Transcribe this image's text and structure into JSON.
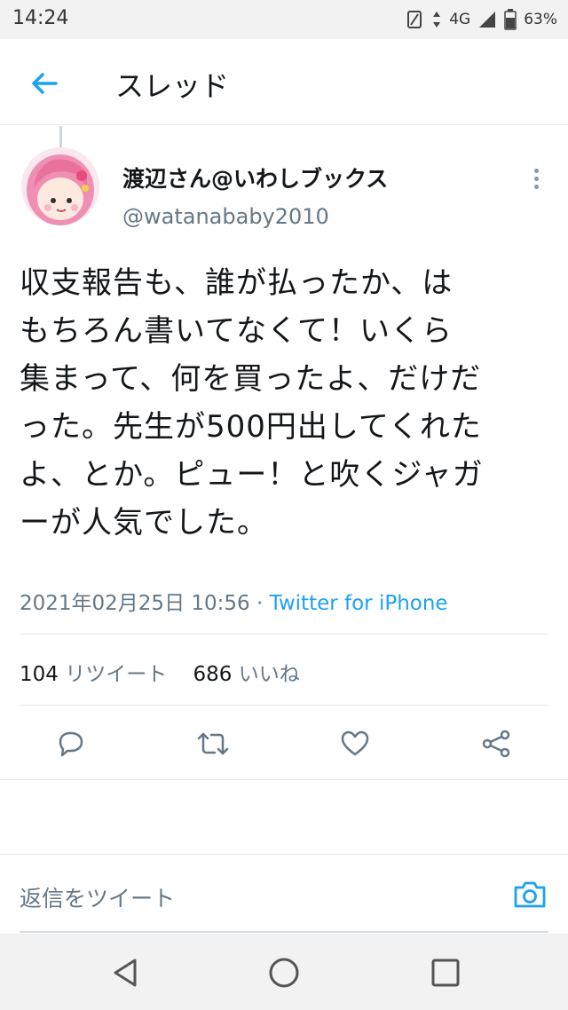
{
  "status": {
    "time": "14:24",
    "network": "4G",
    "battery": "63%"
  },
  "header": {
    "title": "スレッド",
    "back_icon": "arrow-left-icon"
  },
  "tweet": {
    "display_name": "渡辺さん@いわしブックス",
    "handle": "@watanababy2010",
    "lines": [
      "収支報告も、誰が払ったか、は",
      "もちろん書いてなくて！いくら",
      "集まって、何を買ったよ、だけだ",
      "った。先生が500円出してくれた",
      "よ、とか。ピュー！と吹くジャガ",
      "ーが人気でした。"
    ],
    "timestamp": "2021年02月25日 10:56",
    "separator": " · ",
    "source": "Twitter for iPhone",
    "retweet_count": "104",
    "retweet_label": "リツイート",
    "like_count": "686",
    "like_label": "いいね"
  },
  "actions": [
    "reply-icon",
    "retweet-icon",
    "like-icon",
    "share-icon"
  ],
  "reply": {
    "placeholder": "返信をツイート",
    "camera_icon": "camera-icon"
  },
  "colors": {
    "accent": "#1da1f2",
    "secondary_text": "#657786",
    "icon": "#657786"
  }
}
